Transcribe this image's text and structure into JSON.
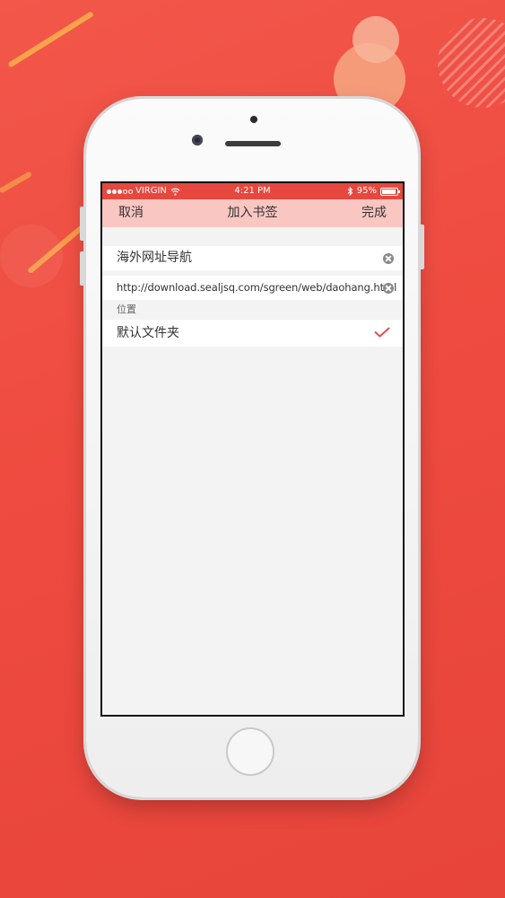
{
  "status_bar": {
    "carrier": "VIRGIN",
    "time": "4:21 PM",
    "battery": "95%",
    "battery_level": 0.95
  },
  "nav": {
    "cancel_label": "取消",
    "title": "加入书签",
    "done_label": "完成"
  },
  "form": {
    "title_value": "海外网址导航",
    "url_value": "http://download.sealjsq.com/sgreen/web/daohang.html",
    "location_label": "位置",
    "folder_name": "默认文件夹"
  },
  "colors": {
    "accent": "#e6483f",
    "nav_bg": "#f9c6c2",
    "checkmark": "#e05050"
  }
}
